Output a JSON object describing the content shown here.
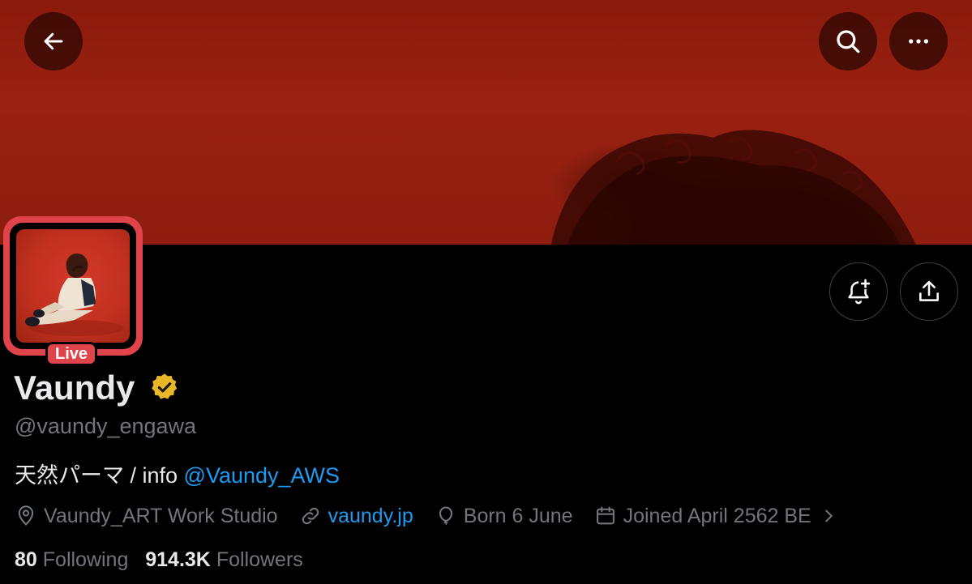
{
  "profile": {
    "name": "Vaundy",
    "handle": "@vaundy_engawa",
    "live_label": "Live",
    "bio_text": "天然パーマ / info ",
    "bio_mention": "@Vaundy_AWS",
    "location": "Vaundy_ART Work Studio",
    "website": "vaundy.jp",
    "birthday": "Born 6 June",
    "joined": "Joined April 2562 BE",
    "following_count": "80",
    "following_label": "Following",
    "followers_count": "914.3K",
    "followers_label": "Followers"
  },
  "icons": {
    "back": "arrow-left-icon",
    "search": "search-icon",
    "more": "more-icon",
    "notify": "bell-plus-icon",
    "share": "share-icon",
    "verified": "verified-badge-icon",
    "location": "location-pin-icon",
    "link": "link-icon",
    "birthday": "balloon-icon",
    "calendar": "calendar-icon",
    "expand": "chevron-right-icon"
  },
  "colors": {
    "accent": "#1d9bf0",
    "live": "#e0434a",
    "verified": "#e8b829",
    "banner": "#9a2212"
  }
}
